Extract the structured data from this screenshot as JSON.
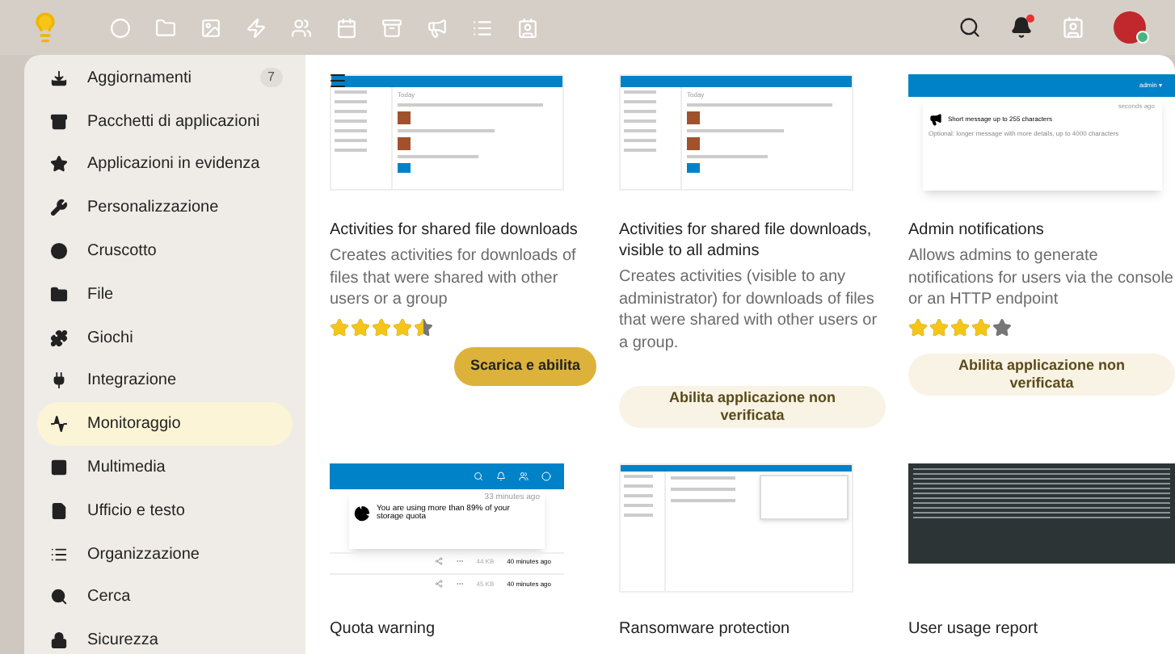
{
  "topbar": {
    "notifications": {
      "unread": true
    },
    "user": {
      "online": true
    }
  },
  "sidebar": {
    "items": [
      {
        "label": "Aggiornamenti",
        "count": "7",
        "selected": false
      },
      {
        "label": "Pacchetti di applicazioni",
        "selected": false
      },
      {
        "label": "Applicazioni in evidenza",
        "selected": false
      },
      {
        "label": "Personalizzazione",
        "selected": false
      },
      {
        "label": "Cruscotto",
        "selected": false
      },
      {
        "label": "File",
        "selected": false
      },
      {
        "label": "Giochi",
        "selected": false
      },
      {
        "label": "Integrazione",
        "selected": false
      },
      {
        "label": "Monitoraggio",
        "selected": true
      },
      {
        "label": "Multimedia",
        "selected": false
      },
      {
        "label": "Ufficio e testo",
        "selected": false
      },
      {
        "label": "Organizzazione",
        "selected": false
      },
      {
        "label": "Cerca",
        "selected": false
      },
      {
        "label": "Sicurezza",
        "selected": false
      }
    ]
  },
  "apps": [
    {
      "name": "Activities for shared file downloads",
      "description": "Creates activities for downloads of files that were shared with other users or a group",
      "stars": 4.5,
      "button": {
        "label": "Scarica e abilita",
        "kind": "primary"
      },
      "preview": {
        "kind": "activity",
        "texts": [
          "Today"
        ]
      }
    },
    {
      "name": "Activities for shared file downloads, visible to all admins",
      "description": "Creates activities (visible to any administrator) for downloads of files that were shared with other users or a group.",
      "button": {
        "label": "Abilita applicazione non verificata",
        "kind": "secondary"
      },
      "preview": {
        "kind": "activity",
        "texts": [
          "Today"
        ]
      }
    },
    {
      "name": "Admin notifications",
      "description": "Allows admins to generate notifications for users via the console or an HTTP endpoint",
      "stars": 4,
      "button": {
        "label": "Abilita applicazione non verificata",
        "kind": "secondary"
      },
      "preview": {
        "kind": "notification",
        "texts": [
          "admin ▾",
          "seconds ago",
          "Short message up to 255 characters",
          "Optional: longer message with more details, up to 4000 characters"
        ]
      }
    },
    {
      "name": "Quota warning",
      "preview": {
        "kind": "quota",
        "texts": [
          "33 minutes ago",
          "You are using more than 89% of your storage quota",
          "44 KB",
          "40 minutes ago",
          "45 KB",
          "40 minutes ago"
        ]
      }
    },
    {
      "name": "Ransomware protection",
      "preview": {
        "kind": "files"
      }
    },
    {
      "name": "User usage report",
      "preview": {
        "kind": "terminal"
      }
    }
  ]
}
